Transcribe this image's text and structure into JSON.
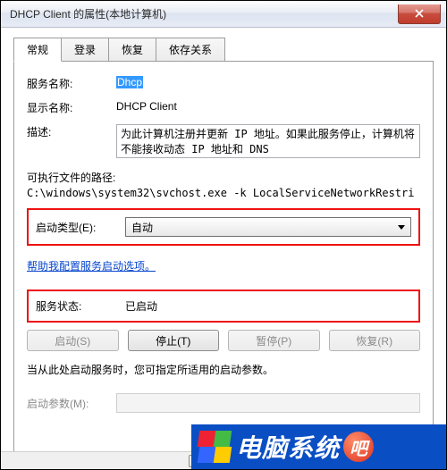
{
  "window": {
    "title": "DHCP Client 的属性(本地计算机)"
  },
  "tabs": [
    "常规",
    "登录",
    "恢复",
    "依存关系"
  ],
  "active_tab": 0,
  "general": {
    "service_name_label": "服务名称:",
    "service_name_value": "Dhcp",
    "display_name_label": "显示名称:",
    "display_name_value": "DHCP Client",
    "description_label": "描述:",
    "description_value": "为此计算机注册并更新 IP 地址。如果此服务停止，计算机将不能接收动态 IP 地址和 DNS",
    "exe_path_label": "可执行文件的路径:",
    "exe_path_value": "C:\\windows\\system32\\svchost.exe -k LocalServiceNetworkRestri",
    "startup_type_label": "启动类型(E):",
    "startup_type_value": "自动",
    "help_link": "帮助我配置服务启动选项。",
    "status_label": "服务状态:",
    "status_value": "已启动",
    "buttons": {
      "start": "启动(S)",
      "stop": "停止(T)",
      "pause": "暂停(P)",
      "resume": "恢复(R)"
    },
    "note": "当从此处启动服务时，您可指定所适用的启动参数。",
    "params_label": "启动参数(M):",
    "params_value": ""
  },
  "watermark": {
    "text": "电脑系统",
    "badge": "吧"
  }
}
